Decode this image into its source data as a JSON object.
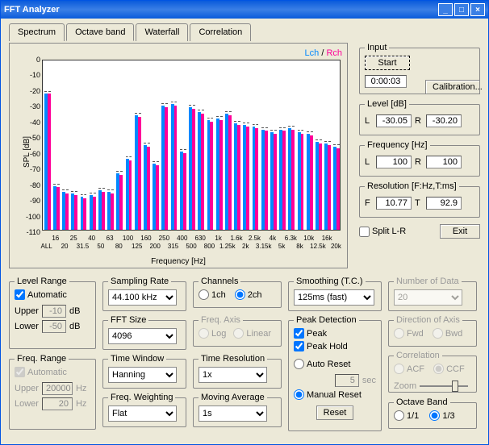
{
  "title": "FFT Analyzer",
  "tabs": [
    "Spectrum",
    "Octave band",
    "Waterfall",
    "Correlation"
  ],
  "active_tab": 1,
  "legend": {
    "lch": "Lch",
    "rch": "Rch",
    "sep": " / "
  },
  "chart_data": {
    "type": "bar",
    "ylabel": "SPL [dB]",
    "xlabel": "Frequency [Hz]",
    "ylim": [
      -110,
      0
    ],
    "yticks": [
      0,
      -10,
      -20,
      -30,
      -40,
      -50,
      -60,
      -70,
      -80,
      -90,
      -100,
      -110
    ],
    "categories": [
      "16",
      "20",
      "25",
      "31.5",
      "40",
      "50",
      "63",
      "80",
      "100",
      "125",
      "160",
      "200",
      "250",
      "315",
      "400",
      "500",
      "630",
      "800",
      "1k",
      "1.25k",
      "1.6k",
      "2k",
      "2.5k",
      "3.15k",
      "4k",
      "5k",
      "6.3k",
      "8k",
      "10k",
      "12.5k",
      "16k",
      "20k"
    ],
    "xticks_two_rows": [
      [
        "16",
        "25",
        "40",
        "63",
        "100",
        "160",
        "250",
        "400",
        "630",
        "1k",
        "1.6k",
        "2.5k",
        "4k",
        "6.3k",
        "10k",
        "16k"
      ],
      [
        "ALL",
        "20",
        "31.5",
        "50",
        "80",
        "125",
        "200",
        "315",
        "500",
        "800",
        "1.25k",
        "2k",
        "3.15k",
        "5k",
        "8k",
        "12.5k",
        "20k"
      ]
    ],
    "series": [
      {
        "name": "Lch",
        "values": [
          -23,
          -82,
          -86,
          -87,
          -89,
          -88,
          -85,
          -86,
          -74,
          -65,
          -37,
          -56,
          -68,
          -31,
          -30,
          -60,
          -32,
          -35,
          -40,
          -39,
          -36,
          -42,
          -43,
          -44,
          -46,
          -48,
          -46,
          -45,
          -48,
          -49,
          -54,
          -55,
          -57,
          -60,
          -61,
          -64
        ]
      },
      {
        "name": "Rch",
        "values": [
          -23,
          -83,
          -87,
          -88,
          -90,
          -89,
          -86,
          -87,
          -75,
          -66,
          -38,
          -57,
          -69,
          -32,
          -31,
          -61,
          -33,
          -36,
          -41,
          -40,
          -37,
          -43,
          -44,
          -45,
          -47,
          -49,
          -47,
          -46,
          -49,
          -50,
          -55,
          -56,
          -58,
          -61,
          -62,
          -65
        ]
      }
    ]
  },
  "input": {
    "label": "Input",
    "start": "Start",
    "time": "0:00:03",
    "calibration": "Calibration..."
  },
  "level_db": {
    "label": "Level [dB]",
    "L": "-30.05",
    "R": "-30.20"
  },
  "freq_hz": {
    "label": "Frequency [Hz]",
    "L": "100",
    "R": "100"
  },
  "resolution": {
    "label": "Resolution [F:Hz,T:ms]",
    "F": "10.77",
    "T": "92.9"
  },
  "split_lr": "Split L-R",
  "exit": "Exit",
  "level_range": {
    "label": "Level Range",
    "automatic": "Automatic",
    "upper_label": "Upper",
    "upper": "-10",
    "lower_label": "Lower",
    "lower": "-50",
    "unit": "dB"
  },
  "freq_range": {
    "label": "Freq. Range",
    "automatic": "Automatic",
    "upper_label": "Upper",
    "upper": "20000",
    "lower_label": "Lower",
    "lower": "20",
    "unit": "Hz"
  },
  "sampling_rate": {
    "label": "Sampling Rate",
    "value": "44.100 kHz"
  },
  "fft_size": {
    "label": "FFT Size",
    "value": "4096"
  },
  "time_window": {
    "label": "Time Window",
    "value": "Hanning"
  },
  "freq_weighting": {
    "label": "Freq. Weighting",
    "value": "Flat"
  },
  "channels": {
    "label": "Channels",
    "ch1": "1ch",
    "ch2": "2ch"
  },
  "freq_axis": {
    "label": "Freq. Axis",
    "log": "Log",
    "linear": "Linear"
  },
  "time_resolution": {
    "label": "Time Resolution",
    "value": "1x"
  },
  "moving_average": {
    "label": "Moving Average",
    "value": "1s"
  },
  "smoothing": {
    "label": "Smoothing (T.C.)",
    "value": "125ms (fast)"
  },
  "peak_detection": {
    "label": "Peak Detection",
    "peak": "Peak",
    "peak_hold": "Peak Hold",
    "auto_reset": "Auto Reset",
    "sec_value": "5",
    "sec": "sec",
    "manual_reset": "Manual Reset",
    "reset": "Reset"
  },
  "number_of_data": {
    "label": "Number of Data",
    "value": "20"
  },
  "direction_of_axis": {
    "label": "Direction of Axis",
    "fwd": "Fwd",
    "bwd": "Bwd"
  },
  "correlation_group": {
    "label": "Correlation",
    "acf": "ACF",
    "ccf": "CCF",
    "zoom": "Zoom"
  },
  "octave_band": {
    "label": "Octave Band",
    "one": "1/1",
    "third": "1/3"
  }
}
